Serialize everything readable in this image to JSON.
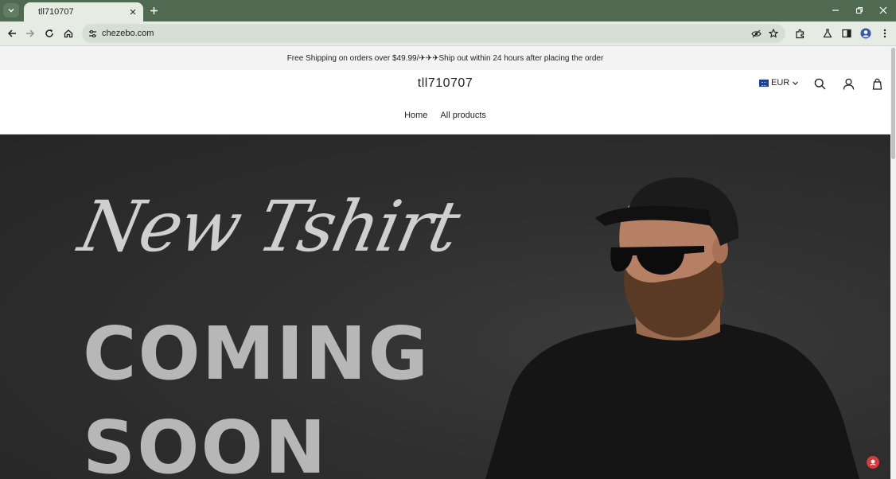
{
  "browser": {
    "tab_title": "tll710707",
    "url": "chezebo.com"
  },
  "announcement": {
    "text": "Free Shipping on orders over $49.99/✈✈✈Ship out within 24 hours after placing the order"
  },
  "header": {
    "logo": "tll710707",
    "currency": "EUR",
    "nav": [
      {
        "label": "Home"
      },
      {
        "label": "All products"
      }
    ]
  },
  "hero": {
    "script_text": "New Tshirt",
    "line1": "COMING",
    "line2": "SOON"
  },
  "colors": {
    "browser_frame": "#506a52",
    "toolbar": "#e6ece3",
    "hero_bg": "#2f2f2f",
    "hero_text": "#b7b7b7"
  }
}
